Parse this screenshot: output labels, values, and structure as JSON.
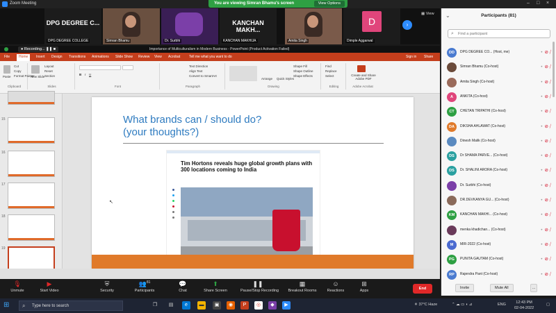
{
  "window": {
    "title": "Zoom Meeting"
  },
  "banner": {
    "viewing": "You are viewing Simran Bhamu's screen",
    "view_options": "View Options"
  },
  "gallery": {
    "tiles": [
      {
        "big": "DPG DEGREE C...",
        "name": "DPG DEGREE COLLEGE"
      },
      {
        "name": "Simran Bhamu"
      },
      {
        "name": "Dr. Surbhi"
      },
      {
        "big": "KANCHAN MAKH...",
        "name": "KANCHAN MAKHIJA"
      },
      {
        "name": "Amita Singh"
      },
      {
        "avatar": "D",
        "name": "Dimple Aggarwal"
      }
    ],
    "view_label": "View"
  },
  "recording": {
    "label": "Recording...",
    "ppt_title": "Importance of Multiculturalism in Modern Business - PowerPoint (Product Activation Failed)"
  },
  "ppt": {
    "tabs": [
      "File",
      "Home",
      "Insert",
      "Design",
      "Transitions",
      "Animations",
      "Slide Show",
      "Review",
      "View",
      "Acrobat",
      "Tell me what you want to do"
    ],
    "tabs_right": [
      "Sign in",
      "Share"
    ],
    "ribbon": {
      "clipboard": [
        "Cut",
        "Copy",
        "Format Painter"
      ],
      "paste": "Paste",
      "slides": [
        "New Slide",
        "Layout",
        "Reset",
        "Section"
      ],
      "paragraph": [
        "Text Direction",
        "Align Text",
        "Convert to SmartArt"
      ],
      "drawing": [
        "Arrange",
        "Quick Styles"
      ],
      "shape": [
        "Shape Fill",
        "Shape Outline",
        "Shape Effects"
      ],
      "editing": [
        "Find",
        "Replace",
        "Select"
      ],
      "acrobat": "Create and Share Adobe PDF",
      "groups": [
        "Clipboard",
        "Slides",
        "Font",
        "Paragraph",
        "Drawing",
        "Editing",
        "Adobe Acrobat"
      ]
    },
    "thumbs": [
      {
        "num": "15"
      },
      {
        "num": "16"
      },
      {
        "num": "17"
      },
      {
        "num": "18"
      },
      {
        "num": "19"
      }
    ],
    "slide": {
      "title1": "What brands can / should do?",
      "title2": "(your thoughts?)",
      "article_headline": "Tim Hortons reveals huge global growth plans with 300 locations coming to India"
    }
  },
  "participants": {
    "header": "Participants (81)",
    "find_placeholder": "Find a participant",
    "list": [
      {
        "initials": "DD",
        "name": "DPG DEGREE CO... (Host, me)",
        "color": "#4a7bd0"
      },
      {
        "initials": "",
        "name": "Simran Bhamu (Co-host)",
        "color": "#6a4a3a"
      },
      {
        "initials": "",
        "name": "Amita Singh (Co-host)",
        "color": "#9a6a5a"
      },
      {
        "initials": "A",
        "name": "ANKITA (Co-host)",
        "color": "#e0457b"
      },
      {
        "initials": "CT",
        "name": "CHETAN TRIPATHI (Co-host)",
        "color": "#2ea043"
      },
      {
        "initials": "DA",
        "name": "DIKSHA AHLAWAT (Co-host)",
        "color": "#e07a2a"
      },
      {
        "initials": "",
        "name": "Dinesh Malik (Co-host)",
        "color": "#5a8ac0"
      },
      {
        "initials": "DS",
        "name": "Dr SHAMA PARVE... (Co-host)",
        "color": "#2aa0a0"
      },
      {
        "initials": "DS",
        "name": "Dr. SHALINI ARORA (Co-host)",
        "color": "#2aa0a0"
      },
      {
        "initials": "",
        "name": "Dr. Surbhi (Co-host)",
        "color": "#7b3fa8"
      },
      {
        "initials": "",
        "name": "DR.DEVKANYA GU... (Co-host)",
        "color": "#8a6a5a"
      },
      {
        "initials": "KM",
        "name": "KANCHAN MAKHI... (Co-host)",
        "color": "#2ea043"
      },
      {
        "initials": "",
        "name": "menka khadichan... (Co-host)",
        "color": "#6a3a5a"
      },
      {
        "initials": "M",
        "name": "MIR-2022 (Co-host)",
        "color": "#4a6ad0"
      },
      {
        "initials": "PG",
        "name": "PUNITA GAUTAM (Co-host)",
        "color": "#2ea043"
      },
      {
        "initials": "RP",
        "name": "Rajendra Pant (Co-host)",
        "color": "#4a7bd0"
      }
    ],
    "invite": "Invite",
    "mute_all": "Mute All",
    "more": "..."
  },
  "toolbar": {
    "items": [
      {
        "label": "Unmute",
        "icon": "microphone-icon"
      },
      {
        "label": "Start Video",
        "icon": "video-icon"
      },
      {
        "label": "Security",
        "icon": "shield-icon"
      },
      {
        "label": "Participants",
        "icon": "participants-icon",
        "count": "81"
      },
      {
        "label": "Chat",
        "icon": "chat-icon"
      },
      {
        "label": "Share Screen",
        "icon": "share-screen-icon"
      },
      {
        "label": "Pause/Stop Recording",
        "icon": "record-icon"
      },
      {
        "label": "Breakout Rooms",
        "icon": "breakout-icon"
      },
      {
        "label": "Reactions",
        "icon": "reactions-icon"
      },
      {
        "label": "Apps",
        "icon": "apps-icon"
      }
    ],
    "end": "End"
  },
  "taskbar": {
    "search": "Type here to search",
    "weather": "37°C Haze",
    "lang": "ENG",
    "time": "12:43 PM",
    "date": "02-04-2022"
  }
}
